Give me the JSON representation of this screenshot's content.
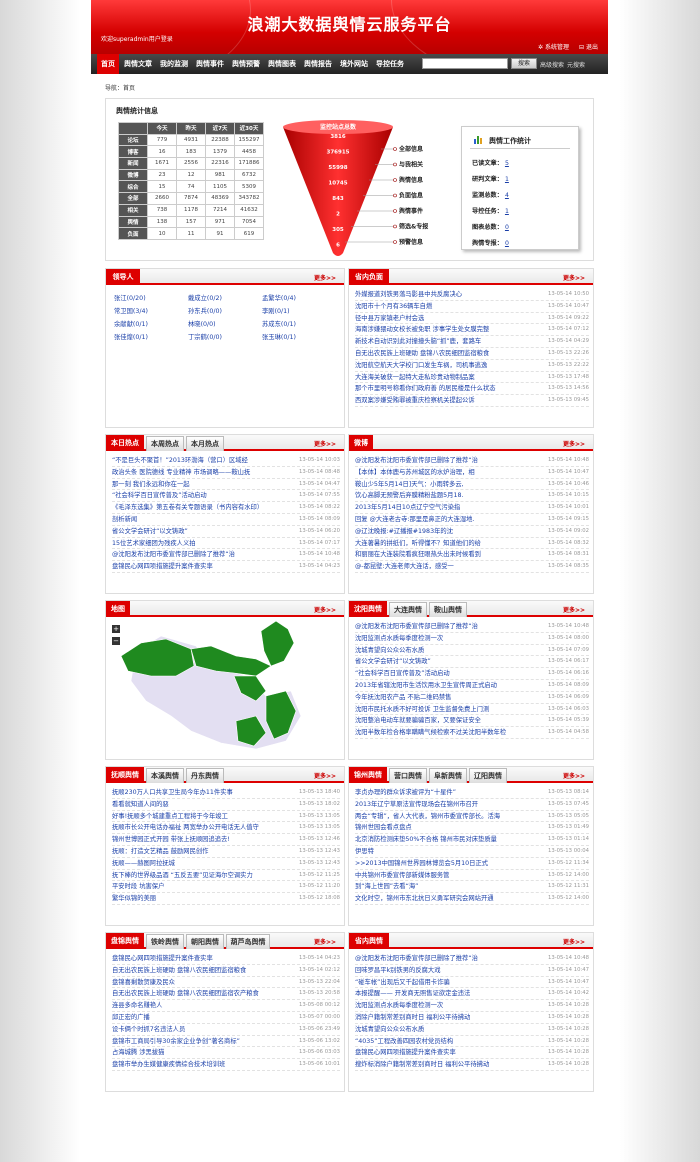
{
  "header": {
    "title": "浪潮大数据舆情云服务平台",
    "welcome": "欢迎superadmin用户登录",
    "links": [
      "系统管理",
      "退出"
    ]
  },
  "nav": {
    "items": [
      "首页",
      "舆情文章",
      "我的监测",
      "舆情事件",
      "舆情预警",
      "舆情图表",
      "舆情报告",
      "境外网站",
      "导控任务"
    ],
    "search_button": "搜索",
    "links": [
      "高级搜索",
      "元搜索"
    ]
  },
  "breadcrumb": "导航：首页",
  "stats": {
    "title": "舆情统计信息",
    "columns": [
      "今天",
      "昨天",
      "近7天",
      "近30天"
    ],
    "rows": [
      {
        "label": "论坛",
        "values": [
          "779",
          "4931",
          "22388",
          "155297"
        ]
      },
      {
        "label": "博客",
        "values": [
          "16",
          "183",
          "1379",
          "4458"
        ]
      },
      {
        "label": "新闻",
        "values": [
          "1671",
          "2556",
          "22316",
          "171886"
        ]
      },
      {
        "label": "微博",
        "values": [
          "23",
          "12",
          "981",
          "6732"
        ]
      },
      {
        "label": "综合",
        "values": [
          "15",
          "74",
          "1105",
          "5309"
        ]
      },
      {
        "label": "全部",
        "values": [
          "2660",
          "7874",
          "48369",
          "343782"
        ]
      },
      {
        "label": "相关",
        "values": [
          "738",
          "1178",
          "7214",
          "41632"
        ]
      },
      {
        "label": "舆情",
        "values": [
          "138",
          "157",
          "971",
          "7054"
        ]
      },
      {
        "label": "负面",
        "values": [
          "10",
          "11",
          "91",
          "619"
        ]
      }
    ]
  },
  "funnel": {
    "title": "监控站点总数",
    "values": [
      "3816",
      "376915",
      "55998",
      "10745",
      "843",
      "2",
      "305",
      "6"
    ],
    "labels": [
      "全部信息",
      "与我相关",
      "舆情信息",
      "负面信息",
      "舆情事件",
      "筛选&专报",
      "预警信息"
    ]
  },
  "work": {
    "title": "舆情工作统计",
    "items": [
      {
        "label": "已读文章：",
        "value": "5"
      },
      {
        "label": "研判文章：",
        "value": "1"
      },
      {
        "label": "监测总数：",
        "value": "4"
      },
      {
        "label": "导控任务：",
        "value": "1"
      },
      {
        "label": "图表总数：",
        "value": "0"
      },
      {
        "label": "舆情专报：",
        "value": "0"
      }
    ]
  },
  "more": "更多>>",
  "leaders": {
    "tab": "领导人",
    "names": [
      "张江(0/20)",
      "戴成立(0/2)",
      "孟繁华(0/4)",
      "常卫国(3/4)",
      "孙东兵(0/0)",
      "李刚(0/1)",
      "余献献(0/1)",
      "林晓(0/0)",
      "苏成东(0/1)",
      "张佳煌(0/1)",
      "丁宗鹤(0/0)",
      "张玉琳(0/1)"
    ]
  },
  "provnews": {
    "tab": "省内负面",
    "rows": [
      {
        "t": "外媒报道刘铁男落马影县中共反腐决心",
        "d": "13-05-14 10:50"
      },
      {
        "t": "沈阳市十个月有36辆车自燃",
        "d": "13-05-14 10:47"
      },
      {
        "t": "径中县万家镇老户村会选",
        "d": "13-05-14 09:22"
      },
      {
        "t": "海南涉嫌猥动女校长被免职 涉事学生处女膜完整",
        "d": "13-05-14 07:12"
      },
      {
        "t": "新技术自动识别此对撞撞头脑“抓”鹿，套路车",
        "d": "13-05-14 04:29"
      },
      {
        "t": "自无出农民族上班硬助 盘锦八农民细团监宿粮食",
        "d": "13-05-13 22:26"
      },
      {
        "t": "沈阳航空航天大学校门口发生车祸，司机事逃逸",
        "d": "13-05-13 22:22"
      },
      {
        "t": "大连海关破获一起特大走私珍贵动物制品案",
        "d": "13-05-13 17:48"
      },
      {
        "t": "那个市里明号称看你们政府善 的居民楼是什么状态",
        "d": "13-05-13 14:56"
      },
      {
        "t": "西双案涉嫌受贿罪被重庆检察机关提起公诉",
        "d": "13-05-13 09:45"
      }
    ]
  },
  "hot": {
    "tabs": [
      "本日热点",
      "本周热点",
      "本月热点"
    ],
    "rows": [
      {
        "t": "“不是巨头不聚首！”2013环渤海（营口）区域经",
        "d": "13-05-14 10:03"
      },
      {
        "t": "政治头条 医院德线 专业精神 市场调略——鞍山抚",
        "d": "13-05-14 08:48"
      },
      {
        "t": "那一刻 我们永远和你在一起",
        "d": "13-05-14 04:47"
      },
      {
        "t": "“社会科学百日宣传普及”活动启动",
        "d": "13-05-14 07:55"
      },
      {
        "t": "《毛泽东选集》第五卷有关专题语录（书内容有水印）",
        "d": "13-05-14 08:22"
      },
      {
        "t": "剖析新闻",
        "d": "13-05-14 08:09"
      },
      {
        "t": "省公文学会研讨“以文铸政”",
        "d": "13-05-14 06:20"
      },
      {
        "t": "15位艺术家细团为残疾人义拍",
        "d": "13-05-14 07:17"
      },
      {
        "t": "@沈阳发布沈阳市委宣传部已删除了推荐“治",
        "d": "13-05-14 10:48"
      },
      {
        "t": "盘锦民心网四项措施提升案件查实率",
        "d": "13-05-14 04:23"
      }
    ]
  },
  "weibo": {
    "tab": "微博",
    "rows": [
      {
        "t": "@沈阳发布沈阳市委宣传部已删除了推荐“治",
        "d": "13-05-14 10:48"
      },
      {
        "t": "【本体】本体鹿与苏州城区的水炉治理，相",
        "d": "13-05-14 10:47"
      },
      {
        "t": "鞍山少5年5月14日]天气：小雨转多云,",
        "d": "13-05-14 10:46"
      },
      {
        "t": "饮心高脚无预警后弃膜精粉盐题5月18.",
        "d": "13-05-14 10:15"
      },
      {
        "t": "2013年5月14日10点辽宁空气污染指",
        "d": "13-05-14 10:01"
      },
      {
        "t": "回复 @大连老古寺:那里是鼻正的大连湿地.",
        "d": "13-05-14 09:15"
      },
      {
        "t": "@辽沈晚报:#辽播报#1983年的沈",
        "d": "13-05-14 09:02"
      },
      {
        "t": "大连著暑的拼纸们，听得懂不？知道他们的给",
        "d": "13-05-14 08:32"
      },
      {
        "t": "和丽丽在大连装院看疯狂眼热头出未时候看到",
        "d": "13-05-14 08:31"
      },
      {
        "t": "@-都昆壁:大连老师大连话，感受一",
        "d": "13-05-14 08:35"
      }
    ]
  },
  "map": {
    "tab": "地图"
  },
  "shenyang": {
    "tabs": [
      "沈阳舆情",
      "大连舆情",
      "鞍山舆情"
    ],
    "rows": [
      {
        "t": "@沈阳发布沈阳市委宣传部已删除了推荐“治",
        "d": "13-05-14 10:48"
      },
      {
        "t": "沈阳监测点水质每季度检测一次",
        "d": "13-05-14 08:00"
      },
      {
        "t": "沈城青望向公众公布水质",
        "d": "13-05-14 07:09"
      },
      {
        "t": "省公文学会研讨“以文铸政”",
        "d": "13-05-14 06:17"
      },
      {
        "t": "“社会科学百日宣传普及”活动启动",
        "d": "13-05-14 06:16"
      },
      {
        "t": "2013年省辖沈阳市生活饮用水卫生宣传周正式启动",
        "d": "13-05-14 08:09"
      },
      {
        "t": "今年抚沈阳农产品 不贴二维码禁售",
        "d": "13-05-14 06:09"
      },
      {
        "t": "沈阳市民托水质不好可投诉 卫生监督免费上门测",
        "d": "13-05-14 06:03"
      },
      {
        "t": "沈阳整治电动车就要骗骗百家，又要保证安全",
        "d": "13-05-14 05:39"
      },
      {
        "t": "沈阳半数年检合格率瞒瞒气候检索不过关沈阳半数年检",
        "d": "13-05-14 04:58"
      }
    ]
  },
  "fushun": {
    "tabs": [
      "抚顺舆情",
      "本溪舆情",
      "丹东舆情"
    ],
    "rows": [
      {
        "t": "抚顺230万人口共享卫生局今年办11件实事",
        "d": "13-05-13 18:40"
      },
      {
        "t": "看看就知道人间的惡",
        "d": "13-05-13 18:02"
      },
      {
        "t": "好事!抚顺多个城建重点工程将于今年竣工",
        "d": "13-05-13 13:05"
      },
      {
        "t": "抚顺市长公开电话办福祉 两宽举办公开电话无人值守",
        "d": "13-05-13 13:05"
      },
      {
        "t": "锦州世博园正式开园 带张上抚顺园追追去!",
        "d": "13-05-13 12:46"
      },
      {
        "t": "抚顺：打造文艺精品 鼓励网民创作",
        "d": "13-05-13 12:43"
      },
      {
        "t": "抚顺——赫图阿拉抚城",
        "d": "13-05-13 12:43"
      },
      {
        "t": "抚下棒的世界级品酒 “五反五要”见证海尔空调实力",
        "d": "13-05-12 11:25"
      },
      {
        "t": "平安时段 坑害保户",
        "d": "13-05-12 11:20"
      },
      {
        "t": "繁华似锦的美丽",
        "d": "13-05-12 18:08"
      }
    ]
  },
  "jinzhou": {
    "tabs": [
      "锦州舆情",
      "营口舆情",
      "阜新舆情",
      "辽阳舆情"
    ],
    "rows": [
      {
        "t": "李贞办理的群众诉求被评为“十星件”",
        "d": "13-05-13 08:14"
      },
      {
        "t": "2013年辽宁草原法宣传现场会在锦州市召开",
        "d": "13-05-13 07:45"
      },
      {
        "t": "两会“专辑”，省人大代表，锦州市委宣传部长。活海",
        "d": "13-05-13 05:05"
      },
      {
        "t": "锦州世园会看点盘点",
        "d": "13-05-13 01:49"
      },
      {
        "t": "北京消防检测床垫50%不合格 锦州市民对床垫质量",
        "d": "13-05-13 01:14"
      },
      {
        "t": "伊思特",
        "d": "13-05-13 00:04"
      },
      {
        "t": ">>2013中国锦州世界园林博览会5月10日正式",
        "d": "13-05-12 11:34"
      },
      {
        "t": "中共锦州市委宣传部新媒体服务管",
        "d": "13-05-12 14:00"
      },
      {
        "t": "到“海上世园”去看“海”",
        "d": "13-05-12 11:31"
      },
      {
        "t": "文化时空，锦州市东北抗日义勇军研究会网站开通",
        "d": "13-05-12 14:00"
      }
    ]
  },
  "panjin": {
    "tabs": [
      "盘锦舆情",
      "铁岭舆情",
      "朝阳舆情",
      "葫芦岛舆情"
    ],
    "rows": [
      {
        "t": "盘锦民心网四项措施提升案件查实率",
        "d": "13-05-14 04:23"
      },
      {
        "t": "自无出农民族上班硬助 盘锦八农民细团监宿粮食",
        "d": "13-05-14 02:12"
      },
      {
        "t": "盘锦喜剩散贺康及民众",
        "d": "13-05-13 22:04"
      },
      {
        "t": "自无出农民族上班硬助 盘锦八农民细团监宿农产粮食",
        "d": "13-05-13 20:58"
      },
      {
        "t": "连县多命名赚艳人",
        "d": "13-05-08 00:12"
      },
      {
        "t": "邱正宏的广播",
        "d": "13-05-07 00:00"
      },
      {
        "t": "设卡俩个时抓7名违法人员",
        "d": "13-05-06 23:49"
      },
      {
        "t": "盘锦市工商局引导30余家企业争创“著名商标”",
        "d": "13-05-06 13:02"
      },
      {
        "t": "占海城腾 涉黑拔猫",
        "d": "13-05-06 03:03"
      },
      {
        "t": "盘锦市举办生媒健康疾情综合技术培训班",
        "d": "13-05-06 10:01"
      }
    ]
  },
  "provnews2": {
    "tab": "省内舆情",
    "rows": [
      {
        "t": "@沈阳发布沈阳市委宣传部已删除了推荐“治",
        "d": "13-05-14 10:48"
      },
      {
        "t": "回味罗昌平k别铁男的反腐大戏",
        "d": "13-05-14 10:47"
      },
      {
        "t": "“碰车帐”出现后又千起借用卡诈骗",
        "d": "13-05-14 10:47"
      },
      {
        "t": "本报提醒—— 开发商无照售证欲定金违法",
        "d": "13-05-14 10:42"
      },
      {
        "t": "沈阳监测点水质每季度检测一次",
        "d": "13-05-14 10:28"
      },
      {
        "t": "消除户籍制常差别商时日 福利公平待拂动",
        "d": "13-05-14 10:28"
      },
      {
        "t": "沈城青望向公众公布水质",
        "d": "13-05-14 10:28"
      },
      {
        "t": "“4035”工程改善四园农村党员结构",
        "d": "13-05-14 10:28"
      },
      {
        "t": "盘锦民心网四项措施提升案件查实率",
        "d": "13-05-14 10:28"
      },
      {
        "t": "搜炸标消除户籍制常差别商时日 福利公平待拂动",
        "d": "13-05-14 10:28"
      }
    ]
  }
}
